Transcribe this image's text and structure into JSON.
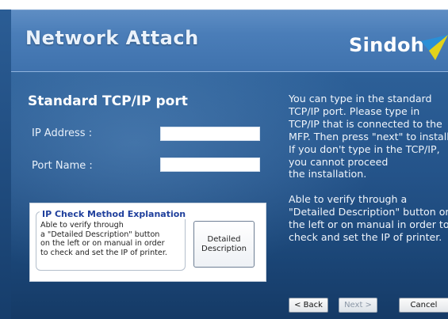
{
  "header": {
    "title": "Network Attach",
    "brand": "Sindoh"
  },
  "form": {
    "section_title": "Standard TCP/IP port",
    "ip_label": "IP Address :",
    "ip_value": "",
    "port_label": "Port Name :",
    "port_value": ""
  },
  "ip_check": {
    "title": "IP Check Method Explanation",
    "lines": [
      "Able to verify through",
      "a \"Detailed Description\" button",
      "on the left or on manual in order",
      "to check and set the IP of printer."
    ],
    "button_line1": "Detailed",
    "button_line2": "Description"
  },
  "help": {
    "paragraph1": [
      "You can type in the standard",
      "TCP/IP port. Please type in",
      "TCP/IP that is connected to the",
      "MFP. Then press \"next\" to install",
      "If you don't type in the TCP/IP,",
      "you cannot proceed",
      "the installation."
    ],
    "paragraph2": [
      "Able to verify through a",
      "\"Detailed Description\" button on",
      "the left or on manual in order to",
      "check and set the IP of printer."
    ]
  },
  "nav": {
    "back_label": "< Back",
    "next_label": "Next >",
    "cancel_label": "Cancel"
  },
  "colors": {
    "brand_mark_blue": "#2a8fd6",
    "brand_mark_yellow": "#e2d21a",
    "info_title": "#1f3f9c"
  },
  "icons": {
    "brand_mark": "sindoh-logo-icon"
  }
}
